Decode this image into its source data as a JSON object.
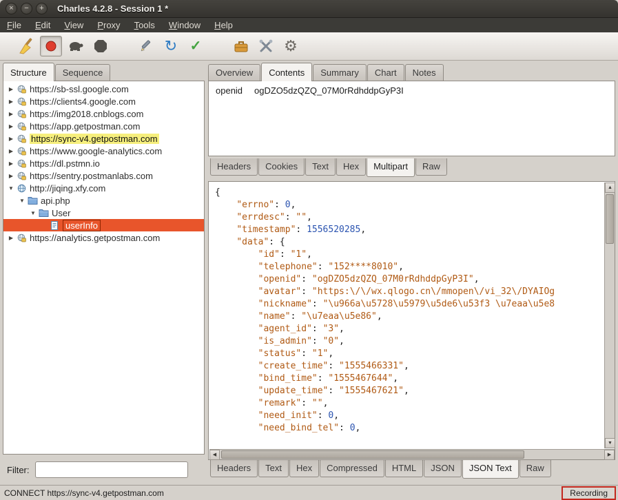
{
  "colors": {
    "selection_orange": "#e8552b",
    "search_highlight_yellow": "#f6ef7d",
    "recording_red": "#c3271d",
    "json_key_color": "#b05a14",
    "json_number_color": "#2a53b0"
  },
  "window": {
    "title": "Charles 4.2.8 - Session 1 *",
    "controls": [
      {
        "name": "close",
        "glyph": "×"
      },
      {
        "name": "minimize",
        "glyph": "−"
      },
      {
        "name": "maximize",
        "glyph": "+"
      }
    ]
  },
  "menubar": [
    "File",
    "Edit",
    "View",
    "Proxy",
    "Tools",
    "Window",
    "Help"
  ],
  "toolbar": {
    "groups": [
      [
        "clear-session",
        "record",
        "throttle",
        "breakpoints"
      ],
      [
        "compose",
        "repeat",
        "validate"
      ],
      [
        "tools",
        "proxy-settings",
        "settings"
      ]
    ],
    "active": "record"
  },
  "sidebar": {
    "tabs": [
      "Structure",
      "Sequence"
    ],
    "active_tab": "Structure",
    "filter_label": "Filter:",
    "filter_value": "",
    "tree": [
      {
        "label": "https://sb-ssl.google.com",
        "level": 0,
        "expander": "collapsed",
        "icon": "secure-site"
      },
      {
        "label": "https://clients4.google.com",
        "level": 0,
        "expander": "collapsed",
        "icon": "secure-site"
      },
      {
        "label": "https://img2018.cnblogs.com",
        "level": 0,
        "expander": "collapsed",
        "icon": "secure-site"
      },
      {
        "label": "https://app.getpostman.com",
        "level": 0,
        "expander": "collapsed",
        "icon": "secure-site"
      },
      {
        "label": "https://sync-v4.getpostman.com",
        "level": 0,
        "expander": "collapsed",
        "icon": "secure-site",
        "highlighted": true
      },
      {
        "label": "https://www.google-analytics.com",
        "level": 0,
        "expander": "collapsed",
        "icon": "secure-site"
      },
      {
        "label": "https://dl.pstmn.io",
        "level": 0,
        "expander": "collapsed",
        "icon": "secure-site"
      },
      {
        "label": "https://sentry.postmanlabs.com",
        "level": 0,
        "expander": "collapsed",
        "icon": "secure-site"
      },
      {
        "label": "http://jiqing.xfy.com",
        "level": 0,
        "expander": "expanded",
        "icon": "site"
      },
      {
        "label": "api.php",
        "level": 1,
        "expander": "expanded",
        "icon": "folder"
      },
      {
        "label": "User",
        "level": 2,
        "expander": "expanded",
        "icon": "folder"
      },
      {
        "label": "userInfo",
        "level": 3,
        "expander": "none",
        "icon": "request",
        "selected": true
      },
      {
        "label": "https://analytics.getpostman.com",
        "level": 0,
        "expander": "collapsed",
        "icon": "secure-site"
      }
    ]
  },
  "content": {
    "tabs": [
      "Overview",
      "Contents",
      "Summary",
      "Chart",
      "Notes"
    ],
    "active_tab": "Contents",
    "request": {
      "fields": [
        {
          "name": "openid",
          "value": "ogDZO5dzQZQ_07M0rRdhddpGyP3I"
        }
      ],
      "tabs": [
        "Headers",
        "Cookies",
        "Text",
        "Hex",
        "Multipart",
        "Raw"
      ],
      "active_tab": "Multipart"
    },
    "response": {
      "tabs": [
        "Headers",
        "Text",
        "Hex",
        "Compressed",
        "HTML",
        "JSON",
        "JSON Text",
        "Raw"
      ],
      "active_tab": "JSON Text",
      "json_lines": [
        {
          "tokens": [
            [
              "p",
              "{"
            ]
          ]
        },
        {
          "tokens": [
            [
              "p",
              "    "
            ],
            [
              "k",
              "\"errno\""
            ],
            [
              "p",
              ": "
            ],
            [
              "n",
              "0"
            ],
            [
              "p",
              ","
            ]
          ]
        },
        {
          "tokens": [
            [
              "p",
              "    "
            ],
            [
              "k",
              "\"errdesc\""
            ],
            [
              "p",
              ": "
            ],
            [
              "s",
              "\"\""
            ],
            [
              "p",
              ","
            ]
          ]
        },
        {
          "tokens": [
            [
              "p",
              "    "
            ],
            [
              "k",
              "\"timestamp\""
            ],
            [
              "p",
              ": "
            ],
            [
              "n",
              "1556520285"
            ],
            [
              "p",
              ","
            ]
          ]
        },
        {
          "tokens": [
            [
              "p",
              "    "
            ],
            [
              "k",
              "\"data\""
            ],
            [
              "p",
              ": {"
            ]
          ]
        },
        {
          "tokens": [
            [
              "p",
              "        "
            ],
            [
              "k",
              "\"id\""
            ],
            [
              "p",
              ": "
            ],
            [
              "s",
              "\"1\""
            ],
            [
              "p",
              ","
            ]
          ]
        },
        {
          "tokens": [
            [
              "p",
              "        "
            ],
            [
              "k",
              "\"telephone\""
            ],
            [
              "p",
              ": "
            ],
            [
              "s",
              "\"152****8010\""
            ],
            [
              "p",
              ","
            ]
          ]
        },
        {
          "tokens": [
            [
              "p",
              "        "
            ],
            [
              "k",
              "\"openid\""
            ],
            [
              "p",
              ": "
            ],
            [
              "s",
              "\"ogDZO5dzQZQ_07M0rRdhddpGyP3I\""
            ],
            [
              "p",
              ","
            ]
          ]
        },
        {
          "tokens": [
            [
              "p",
              "        "
            ],
            [
              "k",
              "\"avatar\""
            ],
            [
              "p",
              ": "
            ],
            [
              "s",
              "\"https:\\/\\/wx.qlogo.cn\\/mmopen\\/vi_32\\/DYAIOg"
            ]
          ]
        },
        {
          "tokens": [
            [
              "p",
              "        "
            ],
            [
              "k",
              "\"nickname\""
            ],
            [
              "p",
              ": "
            ],
            [
              "s",
              "\"\\u966a\\u5728\\u5979\\u5de6\\u53f3 \\u7eaa\\u5e8"
            ]
          ]
        },
        {
          "tokens": [
            [
              "p",
              "        "
            ],
            [
              "k",
              "\"name\""
            ],
            [
              "p",
              ": "
            ],
            [
              "s",
              "\"\\u7eaa\\u5e86\""
            ],
            [
              "p",
              ","
            ]
          ]
        },
        {
          "tokens": [
            [
              "p",
              "        "
            ],
            [
              "k",
              "\"agent_id\""
            ],
            [
              "p",
              ": "
            ],
            [
              "s",
              "\"3\""
            ],
            [
              "p",
              ","
            ]
          ]
        },
        {
          "tokens": [
            [
              "p",
              "        "
            ],
            [
              "k",
              "\"is_admin\""
            ],
            [
              "p",
              ": "
            ],
            [
              "s",
              "\"0\""
            ],
            [
              "p",
              ","
            ]
          ]
        },
        {
          "tokens": [
            [
              "p",
              "        "
            ],
            [
              "k",
              "\"status\""
            ],
            [
              "p",
              ": "
            ],
            [
              "s",
              "\"1\""
            ],
            [
              "p",
              ","
            ]
          ]
        },
        {
          "tokens": [
            [
              "p",
              "        "
            ],
            [
              "k",
              "\"create_time\""
            ],
            [
              "p",
              ": "
            ],
            [
              "s",
              "\"1555466331\""
            ],
            [
              "p",
              ","
            ]
          ]
        },
        {
          "tokens": [
            [
              "p",
              "        "
            ],
            [
              "k",
              "\"bind_time\""
            ],
            [
              "p",
              ": "
            ],
            [
              "s",
              "\"1555467644\""
            ],
            [
              "p",
              ","
            ]
          ]
        },
        {
          "tokens": [
            [
              "p",
              "        "
            ],
            [
              "k",
              "\"update_time\""
            ],
            [
              "p",
              ": "
            ],
            [
              "s",
              "\"1555467621\""
            ],
            [
              "p",
              ","
            ]
          ]
        },
        {
          "tokens": [
            [
              "p",
              "        "
            ],
            [
              "k",
              "\"remark\""
            ],
            [
              "p",
              ": "
            ],
            [
              "s",
              "\"\""
            ],
            [
              "p",
              ","
            ]
          ]
        },
        {
          "tokens": [
            [
              "p",
              "        "
            ],
            [
              "k",
              "\"need_init\""
            ],
            [
              "p",
              ": "
            ],
            [
              "n",
              "0"
            ],
            [
              "p",
              ","
            ]
          ]
        },
        {
          "tokens": [
            [
              "p",
              "        "
            ],
            [
              "k",
              "\"need_bind_tel\""
            ],
            [
              "p",
              ": "
            ],
            [
              "n",
              "0"
            ],
            [
              "p",
              ","
            ]
          ]
        }
      ]
    }
  },
  "statusbar": {
    "left": "CONNECT https://sync-v4.getpostman.com",
    "right": "Recording"
  }
}
